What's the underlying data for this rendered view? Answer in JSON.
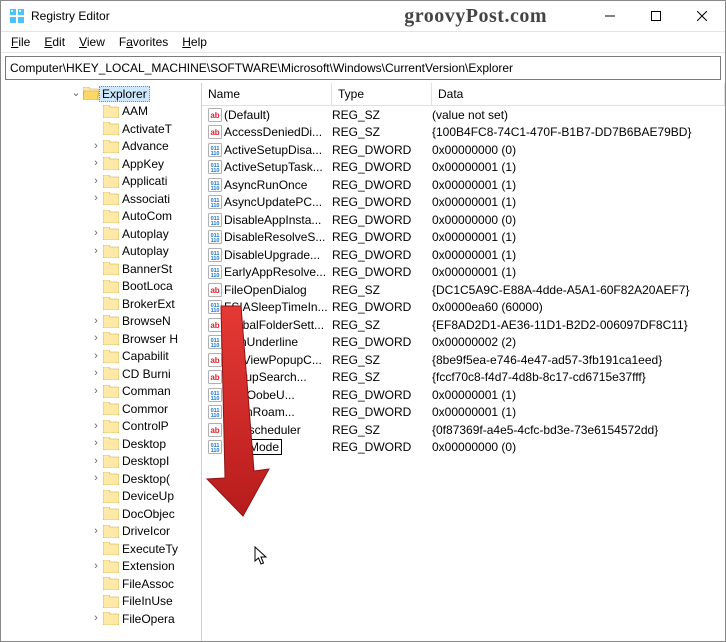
{
  "title": "Registry Editor",
  "watermark": "groovyPost.com",
  "menu": {
    "file": "File",
    "edit": "Edit",
    "view": "View",
    "favorites": "Favorites",
    "help": "Help"
  },
  "address": "Computer\\HKEY_LOCAL_MACHINE\\SOFTWARE\\Microsoft\\Windows\\CurrentVersion\\Explorer",
  "columns": {
    "name": "Name",
    "type": "Type",
    "data": "Data"
  },
  "tree": {
    "selected": "Explorer",
    "items": [
      {
        "label": "AAM",
        "exp": ""
      },
      {
        "label": "ActivateT",
        "exp": ""
      },
      {
        "label": "Advance",
        "exp": ">"
      },
      {
        "label": "AppKey",
        "exp": ">"
      },
      {
        "label": "Applicati",
        "exp": ">"
      },
      {
        "label": "Associati",
        "exp": ">"
      },
      {
        "label": "AutoCom",
        "exp": ""
      },
      {
        "label": "Autoplay",
        "exp": ">"
      },
      {
        "label": "Autoplay",
        "exp": ">"
      },
      {
        "label": "BannerSt",
        "exp": ""
      },
      {
        "label": "BootLoca",
        "exp": ""
      },
      {
        "label": "BrokerExt",
        "exp": ""
      },
      {
        "label": "BrowseN",
        "exp": ">"
      },
      {
        "label": "Browser H",
        "exp": ">"
      },
      {
        "label": "Capabilit",
        "exp": ">"
      },
      {
        "label": "CD Burni",
        "exp": ">"
      },
      {
        "label": "Comman",
        "exp": ">"
      },
      {
        "label": "Commor",
        "exp": ""
      },
      {
        "label": "ControlP",
        "exp": ">"
      },
      {
        "label": "Desktop",
        "exp": ">"
      },
      {
        "label": "DesktopI",
        "exp": ">"
      },
      {
        "label": "Desktop(",
        "exp": ">"
      },
      {
        "label": "DeviceUp",
        "exp": ""
      },
      {
        "label": "DocObjec",
        "exp": ""
      },
      {
        "label": "DriveIcor",
        "exp": ">"
      },
      {
        "label": "ExecuteTy",
        "exp": ""
      },
      {
        "label": "Extension",
        "exp": ">"
      },
      {
        "label": "FileAssoc",
        "exp": ""
      },
      {
        "label": "FileInUse",
        "exp": ""
      },
      {
        "label": "FileOpera",
        "exp": ">"
      }
    ]
  },
  "values": [
    {
      "icon": "sz",
      "name": "(Default)",
      "type": "REG_SZ",
      "data": "(value not set)"
    },
    {
      "icon": "sz",
      "name": "AccessDeniedDi...",
      "type": "REG_SZ",
      "data": "{100B4FC8-74C1-470F-B1B7-DD7B6BAE79BD}"
    },
    {
      "icon": "dw",
      "name": "ActiveSetupDisa...",
      "type": "REG_DWORD",
      "data": "0x00000000 (0)"
    },
    {
      "icon": "dw",
      "name": "ActiveSetupTask...",
      "type": "REG_DWORD",
      "data": "0x00000001 (1)"
    },
    {
      "icon": "dw",
      "name": "AsyncRunOnce",
      "type": "REG_DWORD",
      "data": "0x00000001 (1)"
    },
    {
      "icon": "dw",
      "name": "AsyncUpdatePC...",
      "type": "REG_DWORD",
      "data": "0x00000001 (1)"
    },
    {
      "icon": "dw",
      "name": "DisableAppInsta...",
      "type": "REG_DWORD",
      "data": "0x00000000 (0)"
    },
    {
      "icon": "dw",
      "name": "DisableResolveS...",
      "type": "REG_DWORD",
      "data": "0x00000001 (1)"
    },
    {
      "icon": "dw",
      "name": "DisableUpgrade...",
      "type": "REG_DWORD",
      "data": "0x00000001 (1)"
    },
    {
      "icon": "dw",
      "name": "EarlyAppResolve...",
      "type": "REG_DWORD",
      "data": "0x00000001 (1)"
    },
    {
      "icon": "sz",
      "name": "FileOpenDialog",
      "type": "REG_SZ",
      "data": "{DC1C5A9C-E88A-4dde-A5A1-60F82A20AEF7}"
    },
    {
      "icon": "dw",
      "name": "FSIASleepTimeIn...",
      "type": "REG_DWORD",
      "data": "0x0000ea60 (60000)"
    },
    {
      "icon": "sz",
      "name": "GlobalFolderSett...",
      "type": "REG_SZ",
      "data": "{EF8AD2D1-AE36-11D1-B2D2-006097DF8C11}"
    },
    {
      "icon": "dw",
      "name": "IconUnderline",
      "type": "REG_DWORD",
      "data": "0x00000002 (2)"
    },
    {
      "icon": "sz",
      "name": "ListViewPopupC...",
      "type": "REG_SZ",
      "data": "{8be9f5ea-e746-4e47-ad57-3fb191ca1eed}"
    },
    {
      "icon": "sz",
      "name": "    PopupSearch...",
      "type": "REG_SZ",
      "data": "{fccf70c8-f4d7-4d8b-8c17-cd6715e37fff}"
    },
    {
      "icon": "dw",
      "name": "        hineOobeU...",
      "type": "REG_DWORD",
      "data": "0x00000001 (1)"
    },
    {
      "icon": "dw",
      "name": "        hitOnRoam...",
      "type": "REG_DWORD",
      "data": "0x00000001 (1)"
    },
    {
      "icon": "sz",
      "name": "Taskscheduler",
      "type": "REG_SZ",
      "data": "{0f87369f-a4e5-4cfc-bd3e-73e6154572dd}"
    },
    {
      "icon": "dw",
      "name": "HubMode",
      "type": "REG_DWORD",
      "data": "0x00000000 (0)",
      "editing": true
    }
  ]
}
